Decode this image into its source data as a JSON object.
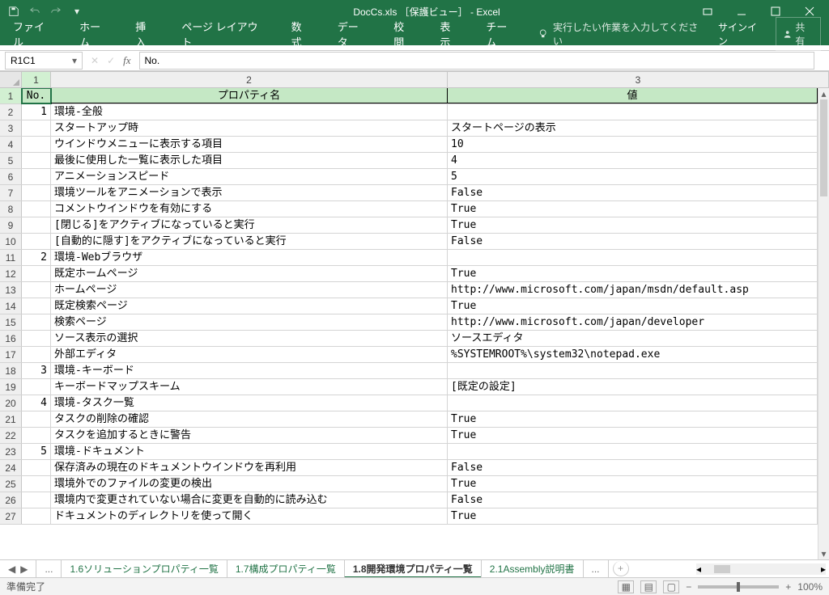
{
  "title": "DocCs.xls ［保護ビュー］ - Excel",
  "qa": [
    "save",
    "undo",
    "redo",
    "more"
  ],
  "winbtns": {
    "restore": "",
    "min": "",
    "max": "",
    "close": ""
  },
  "ribbon": [
    "ファイル",
    "ホーム",
    "挿入",
    "ページ レイアウト",
    "数式",
    "データ",
    "校閲",
    "表示",
    "チーム"
  ],
  "tellme": "実行したい作業を入力してください",
  "signin": "サインイン",
  "share": "共有",
  "namebox": "R1C1",
  "formula": "No.",
  "cols": [
    "1",
    "2",
    "3"
  ],
  "headers": {
    "no": "No.",
    "name": "プロパティ名",
    "val": "値"
  },
  "rows": [
    {
      "no": "1",
      "name": "環境-全般",
      "val": ""
    },
    {
      "no": "",
      "name": "スタートアップ時",
      "val": "スタートページの表示"
    },
    {
      "no": "",
      "name": "ウインドウメニューに表示する項目",
      "val": "10"
    },
    {
      "no": "",
      "name": "最後に使用した一覧に表示した項目",
      "val": "4"
    },
    {
      "no": "",
      "name": "アニメーションスピード",
      "val": "5"
    },
    {
      "no": "",
      "name": "環境ツールをアニメーションで表示",
      "val": "False"
    },
    {
      "no": "",
      "name": "コメントウインドウを有効にする",
      "val": "True"
    },
    {
      "no": "",
      "name": "[閉じる]をアクティブになっていると実行",
      "val": "True"
    },
    {
      "no": "",
      "name": "[自動的に隠す]をアクティブになっていると実行",
      "val": "False"
    },
    {
      "no": "2",
      "name": "環境-Webブラウザ",
      "val": ""
    },
    {
      "no": "",
      "name": "既定ホームページ",
      "val": "True"
    },
    {
      "no": "",
      "name": "ホームページ",
      "val": "http://www.microsoft.com/japan/msdn/default.asp"
    },
    {
      "no": "",
      "name": "既定検索ページ",
      "val": "True"
    },
    {
      "no": "",
      "name": "検索ページ",
      "val": "http://www.microsoft.com/japan/developer"
    },
    {
      "no": "",
      "name": "ソース表示の選択",
      "val": "ソースエディタ"
    },
    {
      "no": "",
      "name": "外部エディタ",
      "val": "%SYSTEMROOT%\\system32\\notepad.exe"
    },
    {
      "no": "3",
      "name": "環境-キーボード",
      "val": ""
    },
    {
      "no": "",
      "name": "キーボードマップスキーム",
      "val": "[既定の設定]"
    },
    {
      "no": "4",
      "name": "環境-タスク一覧",
      "val": ""
    },
    {
      "no": "",
      "name": "タスクの削除の確認",
      "val": "True"
    },
    {
      "no": "",
      "name": "タスクを追加するときに警告",
      "val": "True"
    },
    {
      "no": "5",
      "name": "環境-ドキュメント",
      "val": ""
    },
    {
      "no": "",
      "name": "保存済みの現在のドキュメントウインドウを再利用",
      "val": "False"
    },
    {
      "no": "",
      "name": "環境外でのファイルの変更の検出",
      "val": "True"
    },
    {
      "no": "",
      "name": "環境内で変更されていない場合に変更を自動的に読み込む",
      "val": "False"
    },
    {
      "no": "",
      "name": "ドキュメントのディレクトリを使って開く",
      "val": "True"
    }
  ],
  "sheets": {
    "prev_ell": "...",
    "s1": "1.6ソリューションプロパティ一覧",
    "s2": "1.7構成プロパティ一覧",
    "s3": "1.8開発環境プロパティ一覧",
    "s4": "2.1Assembly説明書",
    "next_ell": "..."
  },
  "status": "準備完了",
  "zoom": "100%"
}
